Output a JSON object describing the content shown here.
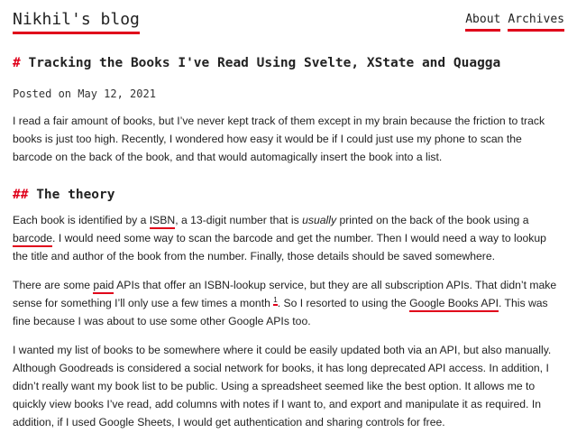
{
  "site": {
    "title": "Nikhil's blog"
  },
  "nav": {
    "items": [
      {
        "label": "About"
      },
      {
        "label": "Archives"
      }
    ]
  },
  "post": {
    "title_marker": "#",
    "title": "Tracking the Books I've Read Using Svelte, XState and Quagga",
    "meta": "Posted on May 12, 2021",
    "intro": "I read a fair amount of books, but I’ve never kept track of them except in my brain because the friction to track books is just too high. Recently, I wondered how easy it would be if I could just use my phone to scan the barcode on the back of the book, and that would automagically insert the book into a list."
  },
  "section": {
    "marker": "##",
    "heading": "The theory",
    "p2": {
      "t1": "Each book is identified by a ",
      "link_isbn": "ISBN",
      "t2": ", a 13-digit number that is ",
      "em": "usually",
      "t3": " printed on the back of the book using a ",
      "link_barcode": "barcode",
      "t4": ". I would need some way to scan the barcode and get the number. Then I would need a way to lookup the title and author of the book from the number. Finally, those details should be saved somewhere."
    },
    "p3": {
      "t1": "There are some ",
      "link_paid": "paid",
      "t2": " APIs that offer an ISBN-lookup service, but they are all subscription APIs. That didn’t make sense for something I’ll only use a few times a month ",
      "footnote": "1",
      "t3": ". So I resorted to using the ",
      "link_gbooks": "Google Books API",
      "t4": ". This was fine because I was about to use some other Google APIs too."
    },
    "p4": "I wanted my list of books to be somewhere where it could be easily updated both via an API, but also manually. Although Goodreads is considered a social network for books, it has long deprecated API access. In addition, I didn’t really want my book list to be public. Using a spreadsheet seemed like the best option. It allows me to quickly view books I’ve read, add columns with notes if I want to, and export and manipulate it as required. In addition, if I used Google Sheets, I would get authentication and sharing controls for free."
  },
  "colors": {
    "accent": "#e0001a",
    "text": "#222222",
    "background": "#ffffff"
  }
}
